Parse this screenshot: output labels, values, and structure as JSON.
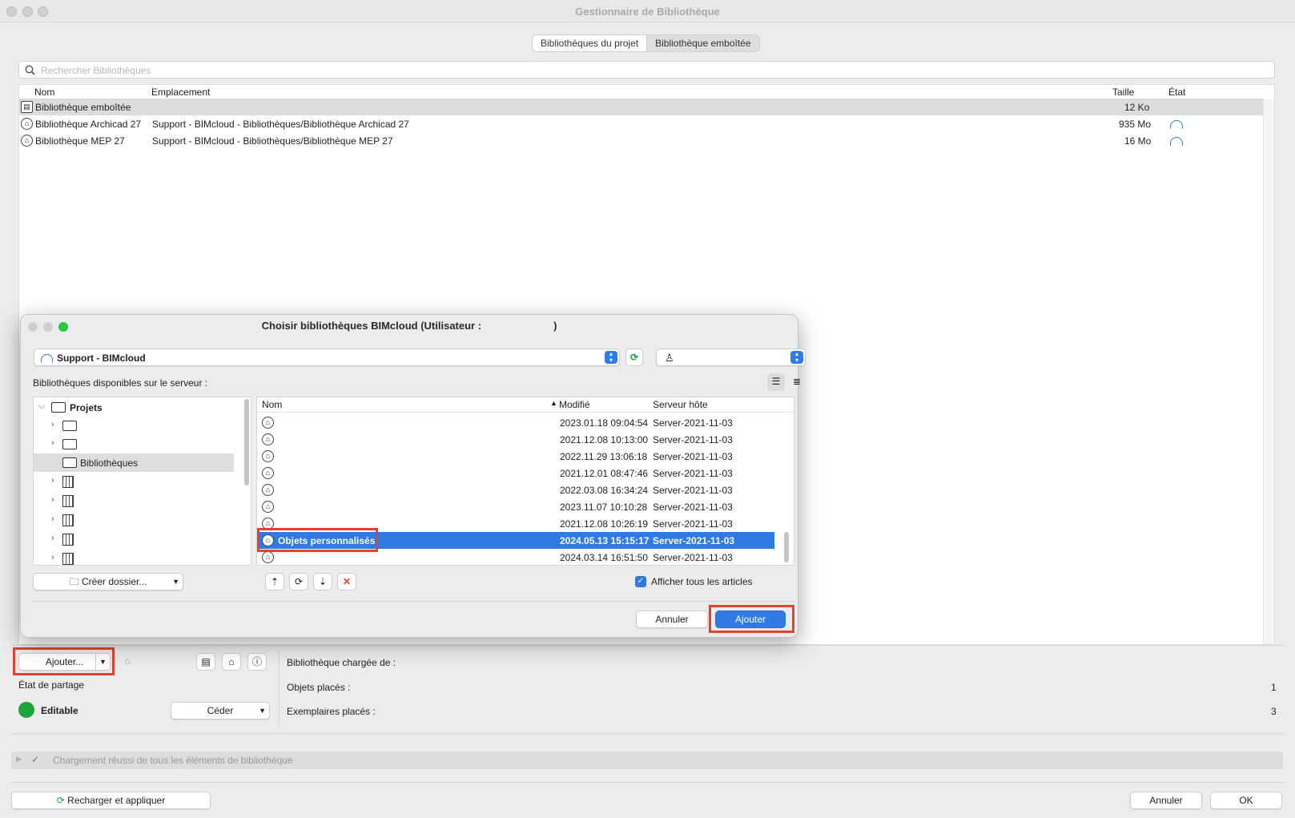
{
  "window": {
    "title": "Gestionnaire de Bibliothèque"
  },
  "tabs": [
    {
      "label": "Bibliothèques du projet",
      "active": true
    },
    {
      "label": "Bibliothèque emboîtée",
      "active": false
    }
  ],
  "search": {
    "placeholder": "Rechercher Bibliothèques"
  },
  "library_list": {
    "columns": [
      "Nom",
      "Emplacement",
      "Taille",
      "État"
    ],
    "rows": [
      {
        "name": "Bibliothèque emboîtée",
        "location": "",
        "size": "12 Ko",
        "state_icon": "none",
        "selected": true
      },
      {
        "name": "Bibliothèque Archicad 27",
        "location": "Support - BIMcloud - Bibliothèques/Bibliothèque Archicad 27",
        "size": "935 Mo",
        "state_icon": "cloud-icon"
      },
      {
        "name": "Bibliothèque MEP 27",
        "location": "Support - BIMcloud - Bibliothèques/Bibliothèque MEP 27",
        "size": "16 Mo",
        "state_icon": "cloud-icon"
      }
    ]
  },
  "dialog": {
    "title": "Choisir bibliothèques BIMcloud (Utilisateur :",
    "title_end": ")",
    "server_popup": "Support - BIMcloud",
    "available_label": "Bibliothèques disponibles sur le serveur :",
    "tree": {
      "root": "Projets",
      "selected": "Bibliothèques"
    },
    "create_folder": "Créer dossier...",
    "file_columns": [
      "Nom",
      "Modifié",
      "Serveur hôte"
    ],
    "files": [
      {
        "name": "",
        "modified": "2023.01.18 09:04:54",
        "host": "Server-2021-11-03"
      },
      {
        "name": "",
        "modified": "2021.12.08 10:13:00",
        "host": "Server-2021-11-03"
      },
      {
        "name": "",
        "modified": "2022.11.29 13:06:18",
        "host": "Server-2021-11-03"
      },
      {
        "name": "",
        "modified": "2021.12.01 08:47:46",
        "host": "Server-2021-11-03"
      },
      {
        "name": "",
        "modified": "2022.03.08 16:34:24",
        "host": "Server-2021-11-03"
      },
      {
        "name": "",
        "modified": "2023.11.07 10:10:28",
        "host": "Server-2021-11-03"
      },
      {
        "name": "",
        "modified": "2021.12.08 10:26:19",
        "host": "Server-2021-11-03"
      },
      {
        "name": "Objets personnalisés",
        "modified": "2024.05.13 15:15:17",
        "host": "Server-2021-11-03",
        "selected": true
      },
      {
        "name": "",
        "modified": "2024.03.14 16:51:50",
        "host": "Server-2021-11-03"
      }
    ],
    "show_all_label": "Afficher tous les articles",
    "show_all_checked": true,
    "cancel_label": "Annuler",
    "add_label": "Ajouter"
  },
  "bottom": {
    "add_button": "Ajouter...",
    "sharing_state_label": "État de partage",
    "editable_label": "Editable",
    "release_button": "Céder",
    "loaded_from_label": "Bibliothèque chargée de :",
    "placed_objects_label": "Objets placés :",
    "placed_objects_value": "1",
    "placed_instances_label": "Exemplaires placés :",
    "placed_instances_value": "3",
    "status_message": "Chargement réussi de tous les éléments de bibliothèque",
    "reload_button": "Recharger et appliquer",
    "cancel_button": "Annuler",
    "ok_button": "OK"
  },
  "colors": {
    "accent": "#2f7ae5",
    "highlight": "#e0432b",
    "editable_status": "#1fa33b"
  }
}
